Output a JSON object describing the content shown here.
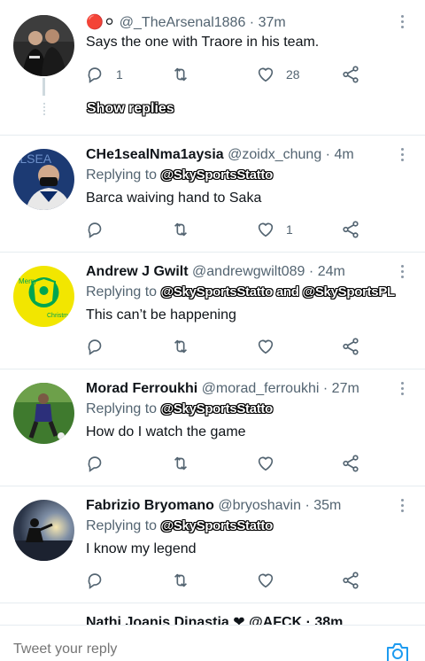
{
  "tweets": [
    {
      "prefix_emoji": "🔴⚪",
      "display_name": "",
      "handle": "@_TheArsenal1886",
      "time": "37m",
      "replying_label": "",
      "mentions": "",
      "text": "Says the one with Traore in his team.",
      "reply_count": "1",
      "retweet_count": "",
      "like_count": "28"
    },
    {
      "display_name": "CHe1sealNma1aysia",
      "handle": "@zoidx_chung",
      "time": "4m",
      "replying_label": "Replying to",
      "mentions": "@SkySportsStatto",
      "text": "Barca waiving hand to Saka",
      "reply_count": "",
      "retweet_count": "",
      "like_count": "1"
    },
    {
      "display_name": "Andrew J Gwilt",
      "handle": "@andrewgwilt089",
      "time": "24m",
      "replying_label": "Replying to",
      "mentions": "@SkySportsStatto and @SkySportsPL",
      "text": "This can’t be happening",
      "reply_count": "",
      "retweet_count": "",
      "like_count": ""
    },
    {
      "display_name": "Morad Ferroukhi",
      "handle": "@morad_ferroukhi",
      "time": "27m",
      "replying_label": "Replying to",
      "mentions": "@SkySportsStatto",
      "text": "How do I watch the game",
      "reply_count": "",
      "retweet_count": "",
      "like_count": ""
    },
    {
      "display_name": "Fabrizio Bryomano",
      "handle": "@bryoshavin",
      "time": "35m",
      "replying_label": "Replying to",
      "mentions": "@SkySportsStatto",
      "text": "I know my legend",
      "reply_count": "",
      "retweet_count": "",
      "like_count": ""
    }
  ],
  "show_replies": "Show replies",
  "partial_tweet_text": "Nathi Joanis Dinastia ❤ @AFCK · 38m",
  "composer": {
    "placeholder": "Tweet your reply"
  },
  "colors": {
    "icon": "#536471",
    "divider": "#e6ecf0",
    "accent": "#1d9bf0"
  }
}
